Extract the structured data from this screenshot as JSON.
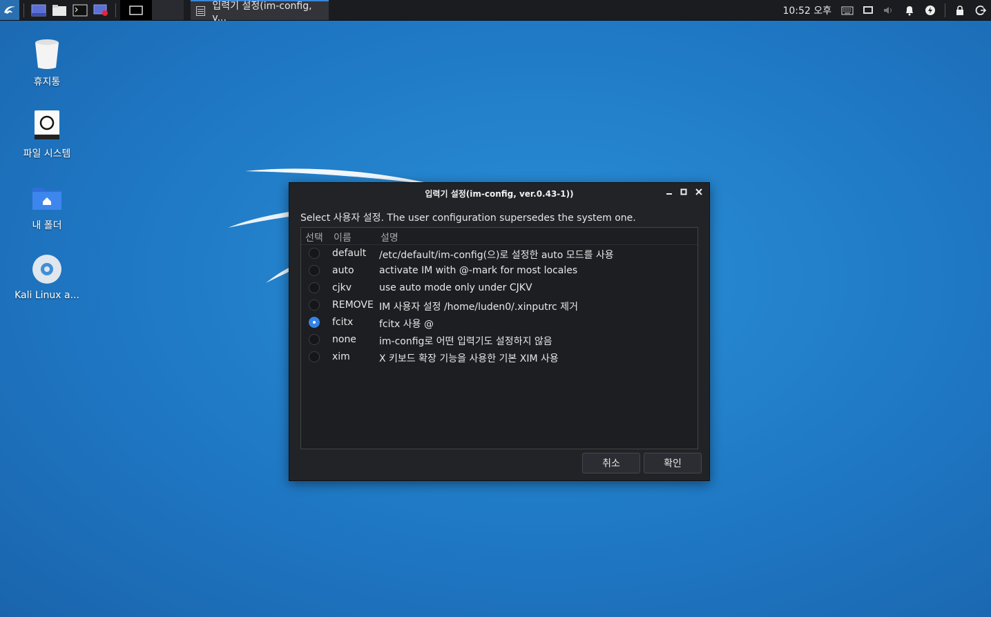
{
  "taskbar": {
    "active_window_title": "입력기 설정(im-config, v...",
    "clock": "10:52 오후"
  },
  "desktop": {
    "icons": [
      {
        "label": "휴지통",
        "icon": "trash-icon"
      },
      {
        "label": "파일 시스템",
        "icon": "drive-icon"
      },
      {
        "label": "내 폴더",
        "icon": "home-folder-icon"
      },
      {
        "label": "Kali Linux a...",
        "icon": "disc-icon"
      }
    ]
  },
  "dialog": {
    "title": "입력기 설정(im-config, ver.0.43-1))",
    "prompt": "Select 사용자 설정. The user configuration supersedes the system one.",
    "columns": {
      "select": "선택",
      "name": "이름",
      "description": "설명"
    },
    "rows": [
      {
        "name": "default",
        "description": "/etc/default/im-config(으)로 설정한 auto 모드를 사용",
        "selected": false
      },
      {
        "name": "auto",
        "description": "activate IM with @-mark for most locales",
        "selected": false
      },
      {
        "name": "cjkv",
        "description": "use auto mode only under CJKV",
        "selected": false
      },
      {
        "name": "REMOVE",
        "description": "IM 사용자 설정 /home/luden0/.xinputrc 제거",
        "selected": false
      },
      {
        "name": "fcitx",
        "description": "fcitx 사용 @",
        "selected": true
      },
      {
        "name": "none",
        "description": "im-config로 어떤 입력기도 설정하지 않음",
        "selected": false
      },
      {
        "name": "xim",
        "description": "X 키보드 확장 기능을 사용한 기본 XIM 사용",
        "selected": false
      }
    ],
    "cancel_label": "취소",
    "ok_label": "확인"
  },
  "colors": {
    "accent": "#3584e4",
    "dialog_bg": "#222327",
    "panel_bg": "#1b1c20"
  }
}
